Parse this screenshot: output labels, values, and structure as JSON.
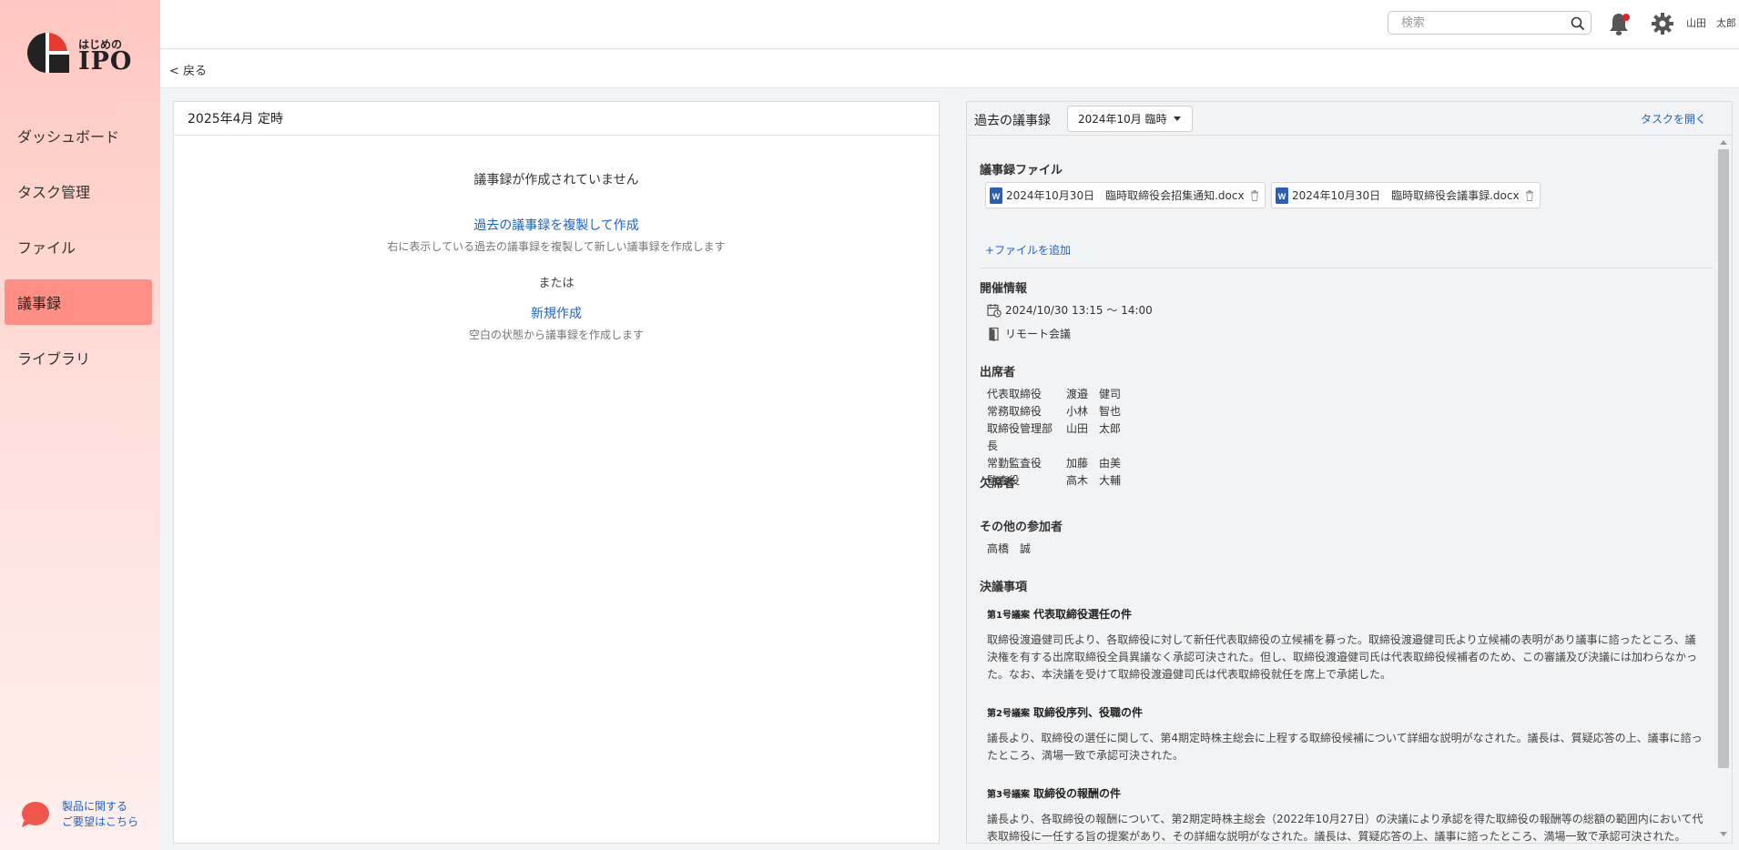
{
  "brand": {
    "logo_small": "はじめの",
    "logo_big": "IPO",
    "accent": "#ff8f85",
    "logo_red": "#e63b2e"
  },
  "sidebar": {
    "items": [
      {
        "label": "ダッシュボード"
      },
      {
        "label": "タスク管理"
      },
      {
        "label": "ファイル"
      },
      {
        "label": "議事録"
      },
      {
        "label": "ライブラリ"
      }
    ],
    "active_index": 3,
    "feedback_line1": "製品に関する",
    "feedback_line2": "ご要望はこちら"
  },
  "header": {
    "search_placeholder": "検索",
    "user_name": "山田　太郎",
    "icons": [
      "search-icon",
      "bell-icon",
      "gear-icon"
    ]
  },
  "backbar": {
    "back_label": "<  戻る"
  },
  "left_panel": {
    "title": "2025年4月 定時",
    "empty_message": "議事録が作成されていません",
    "copy_link": "過去の議事録を複製して作成",
    "copy_desc": "右に表示している過去の議事録を複製して新しい議事録を作成します",
    "or_text": "または",
    "new_link": "新規作成",
    "new_desc": "空白の状態から議事録を作成します"
  },
  "right_panel": {
    "title": "過去の議事録",
    "selected_meeting": "2024年10月 臨時",
    "open_task_link": "タスクを開く",
    "files_label": "議事録ファイル",
    "files": [
      {
        "name": "2024年10月30日　臨時取締役会招集通知.docx"
      },
      {
        "name": "2024年10月30日　臨時取締役会議事録.docx"
      }
    ],
    "add_file": "+ファイルを追加",
    "meeting_info_label": "開催情報",
    "datetime": "2024/10/30 13:15 〜 14:00",
    "location": "リモート会議",
    "attendees_label": "出席者",
    "attendees": [
      {
        "role": "代表取締役",
        "name": "渡邉　健司"
      },
      {
        "role": "常務取締役",
        "name": "小林　智也"
      },
      {
        "role": "取締役管理部",
        "name": "山田　太郎"
      },
      {
        "role": "長",
        "name": ""
      },
      {
        "role": "常勤監査役",
        "name": "加藤　由美"
      },
      {
        "role": "監査役",
        "name": "高木　大輔"
      }
    ],
    "absentees_label": "欠席者",
    "others_label": "その他の参加者",
    "others": "高橋　誠",
    "resolutions_label": "決議事項",
    "resolutions": [
      {
        "number": "第1号議案",
        "title": "代表取締役選任の件",
        "body": "取締役渡邉健司氏より、各取締役に対して新任代表取締役の立候補を募った。取締役渡邉健司氏より立候補の表明があり議事に諮ったところ、議決権を有する出席取締役全員異議なく承認可決された。但し、取締役渡邉健司氏は代表取締役候補者のため、この審議及び決議には加わらなかった。なお、本決議を受けて取締役渡邉健司氏は代表取締役就任を席上で承諾した。"
      },
      {
        "number": "第2号議案",
        "title": "取締役序列、役職の件",
        "body": "議長より、取締役の選任に関して、第4期定時株主総会に上程する取締役候補について詳細な説明がなされた。議長は、質疑応答の上、議事に諮ったところ、満場一致で承認可決された。"
      },
      {
        "number": "第3号議案",
        "title": "取締役の報酬の件",
        "body": "議長より、各取締役の報酬について、第2期定時株主総会（2022年10月27日）の決議により承認を得た取締役の報酬等の総額の範囲内において代表取締役に一任する旨の提案があり、その詳細な説明がなされた。議長は、質疑応答の上、議事に諮ったところ、満場一致で承認可決された。"
      }
    ]
  }
}
